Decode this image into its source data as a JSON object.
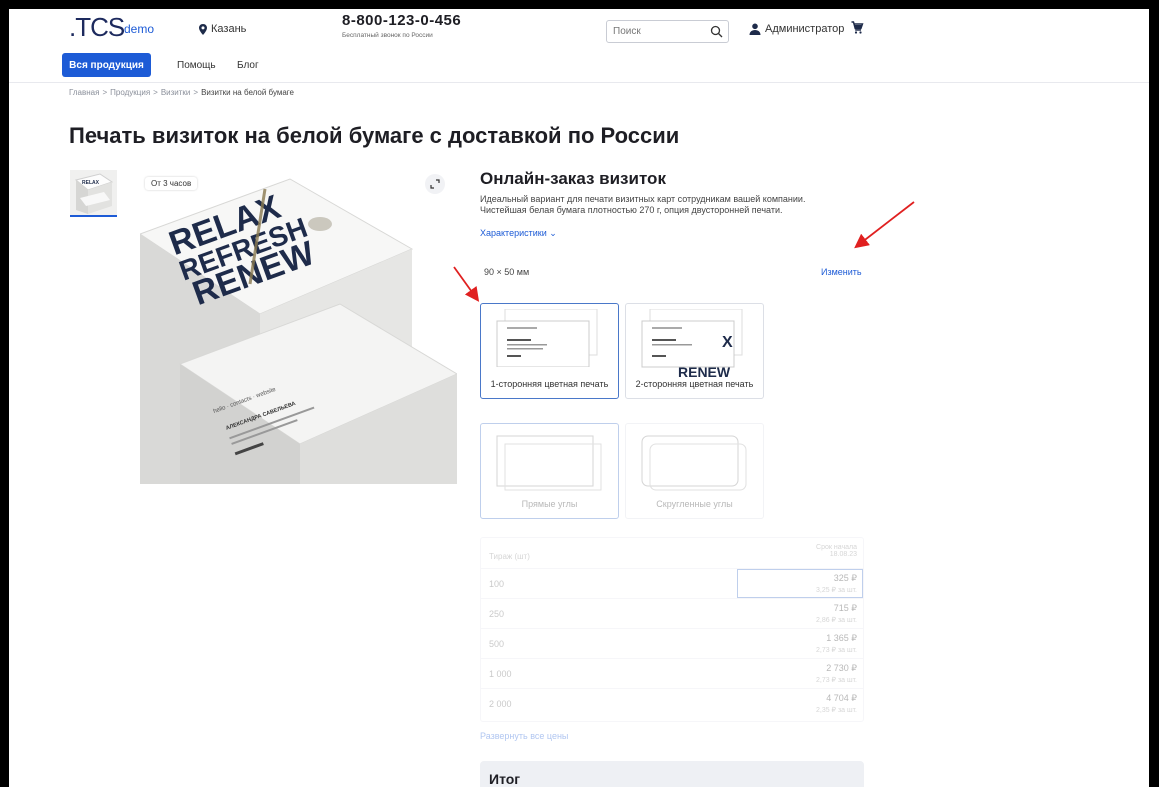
{
  "header": {
    "logo": ".TCS",
    "logo_suffix": "demo",
    "city": "Казань",
    "phone": "8-800-123-0-456",
    "phone_note": "Бесплатный звонок по России",
    "search_placeholder": "Поиск",
    "user": "Администратор"
  },
  "nav": {
    "products_button": "Вся продукция",
    "help": "Помощь",
    "blog": "Блог"
  },
  "breadcrumbs": [
    "Главная",
    ">",
    "Продукция",
    ">",
    "Визитки",
    ">",
    "Визитки на белой бумаге"
  ],
  "page_title": "Печать визиток на белой бумаге с доставкой по России",
  "gallery": {
    "time_badge": "От 3 часов",
    "card_text": [
      "RELAX",
      "REFRESH",
      "RENEW"
    ],
    "card_name": "АЛЕКСАНДРА САВЕЛЬЕВА"
  },
  "order": {
    "title": "Онлайн-заказ визиток",
    "description_line1": "Идеальный вариант для печати визитных карт сотрудникам вашей компании.",
    "description_line2": "Чистейшая белая бумага плотностью 270 г, опция двусторонней печати.",
    "characteristics_link": "Характеристики ⌄",
    "size": "90 × 50 мм",
    "change_link": "Изменить",
    "print_options": [
      "1-сторонняя цветная печать",
      "2-сторонняя цветная печать"
    ],
    "corner_options": [
      "Прямые углы",
      "Скругленные углы"
    ],
    "option2_preview_text": "RENEW",
    "table": {
      "qty_header": "Тираж (шт)",
      "date_header_line1": "Срок начала",
      "date_header_line2": "18.08.23",
      "rows": [
        {
          "qty": "100",
          "price": "325 ₽",
          "per": "3,25 ₽ за шт."
        },
        {
          "qty": "250",
          "price": "715 ₽",
          "per": "2,86 ₽ за шт."
        },
        {
          "qty": "500",
          "price": "1 365 ₽",
          "per": "2,73 ₽ за шт."
        },
        {
          "qty": "1 000",
          "price": "2 730 ₽",
          "per": "2,73 ₽ за шт."
        },
        {
          "qty": "2 000",
          "price": "4 704 ₽",
          "per": "2,35 ₽ за шт."
        }
      ]
    },
    "expand_prices": "Развернуть все цены",
    "total_label": "Итог"
  },
  "colors": {
    "accent": "#1d5bd6",
    "annotation_arrow": "#e02020"
  }
}
